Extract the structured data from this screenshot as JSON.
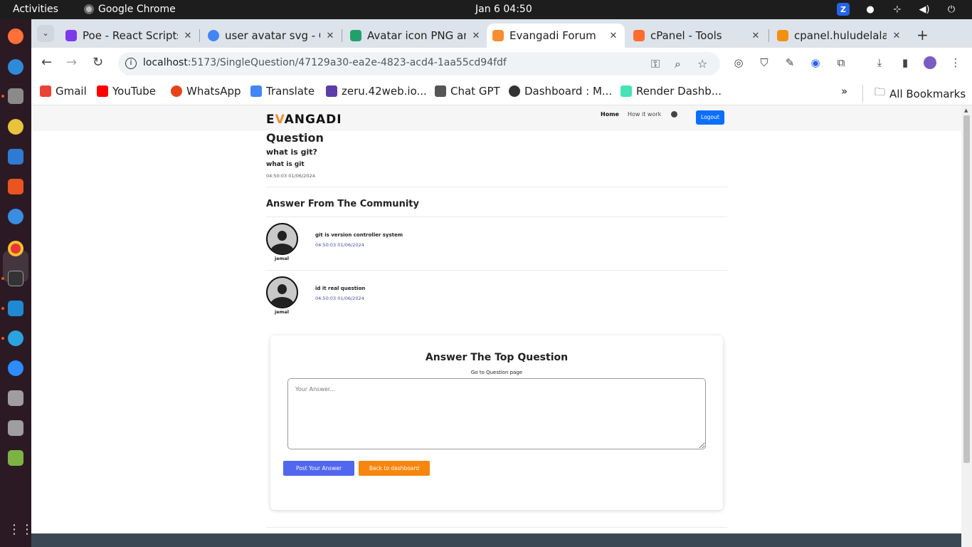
{
  "system": {
    "activities": "Activities",
    "app_name": "Google Chrome",
    "clock": "Jan 6  04:50"
  },
  "tabs": [
    {
      "title": "Poe - React Scripts [",
      "icon": "poe-icon",
      "color": "#7c3aed",
      "active": false
    },
    {
      "title": "user avatar svg - Go",
      "icon": "google-icon",
      "color": "#4285f4",
      "active": false
    },
    {
      "title": "Avatar icon PNG an",
      "icon": "avatar-site-icon",
      "color": "#22a06b",
      "active": false
    },
    {
      "title": "Evangadi Forum",
      "icon": "evangadi-icon",
      "color": "#f68d2e",
      "active": true
    },
    {
      "title": "cPanel - Tools",
      "icon": "cpanel-icon",
      "color": "#ff6c2c",
      "active": false
    },
    {
      "title": "cpanel.huludelala.c",
      "icon": "phpmyadmin-icon",
      "color": "#f29111",
      "active": false
    }
  ],
  "address": {
    "host": "localhost",
    "path": ":5173/SingleQuestion/47129a30-ea2e-4823-acd4-1aa55cd94fdf"
  },
  "bookmarks": [
    {
      "label": "Gmail",
      "icon": "gmail-icon",
      "color": "#ea4335"
    },
    {
      "label": "YouTube",
      "icon": "youtube-icon",
      "color": "#ff0000"
    },
    {
      "label": "WhatsApp",
      "icon": "whatsapp-icon",
      "color": "#e5441a"
    },
    {
      "label": "Translate",
      "icon": "translate-icon",
      "color": "#4285f4"
    },
    {
      "label": "zeru.42web.io...",
      "icon": "link-icon",
      "color": "#5c3ea8"
    },
    {
      "label": "Chat GPT",
      "icon": "chatgpt-icon",
      "color": "#555555"
    },
    {
      "label": "Dashboard : M...",
      "icon": "dashboard-icon",
      "color": "#333333"
    },
    {
      "label": "Render Dashb...",
      "icon": "render-icon",
      "color": "#46e3b7"
    }
  ],
  "all_bookmarks": "All Bookmarks",
  "site": {
    "logo_prefix": "E",
    "logo_accent": "V",
    "logo_suffix": "ANGADI",
    "nav_home": "Home",
    "nav_how": "How it work",
    "logout": "Logout"
  },
  "question": {
    "heading": "Question",
    "title": "what is git?",
    "description": "what is git",
    "timestamp": "04:50:03 01/06/2024"
  },
  "community_title": "Answer From The Community",
  "answers": [
    {
      "text": "git is version controller system",
      "timestamp": "04:50:03 01/06/2024",
      "user": "jemal"
    },
    {
      "text": "id it real question",
      "timestamp": "04:50:03 01/06/2024",
      "user": "jemal"
    }
  ],
  "answer_form": {
    "title": "Answer The Top Question",
    "link": "Go to Question page",
    "placeholder": "Your Answer...",
    "post_label": "Post Your Answer",
    "back_label": "Back to dashboard"
  },
  "colors": {
    "accent": "#f68d2e",
    "logout": "#0b6efd",
    "post": "#5167ef",
    "back": "#f7860e",
    "footer": "#3b4854"
  }
}
